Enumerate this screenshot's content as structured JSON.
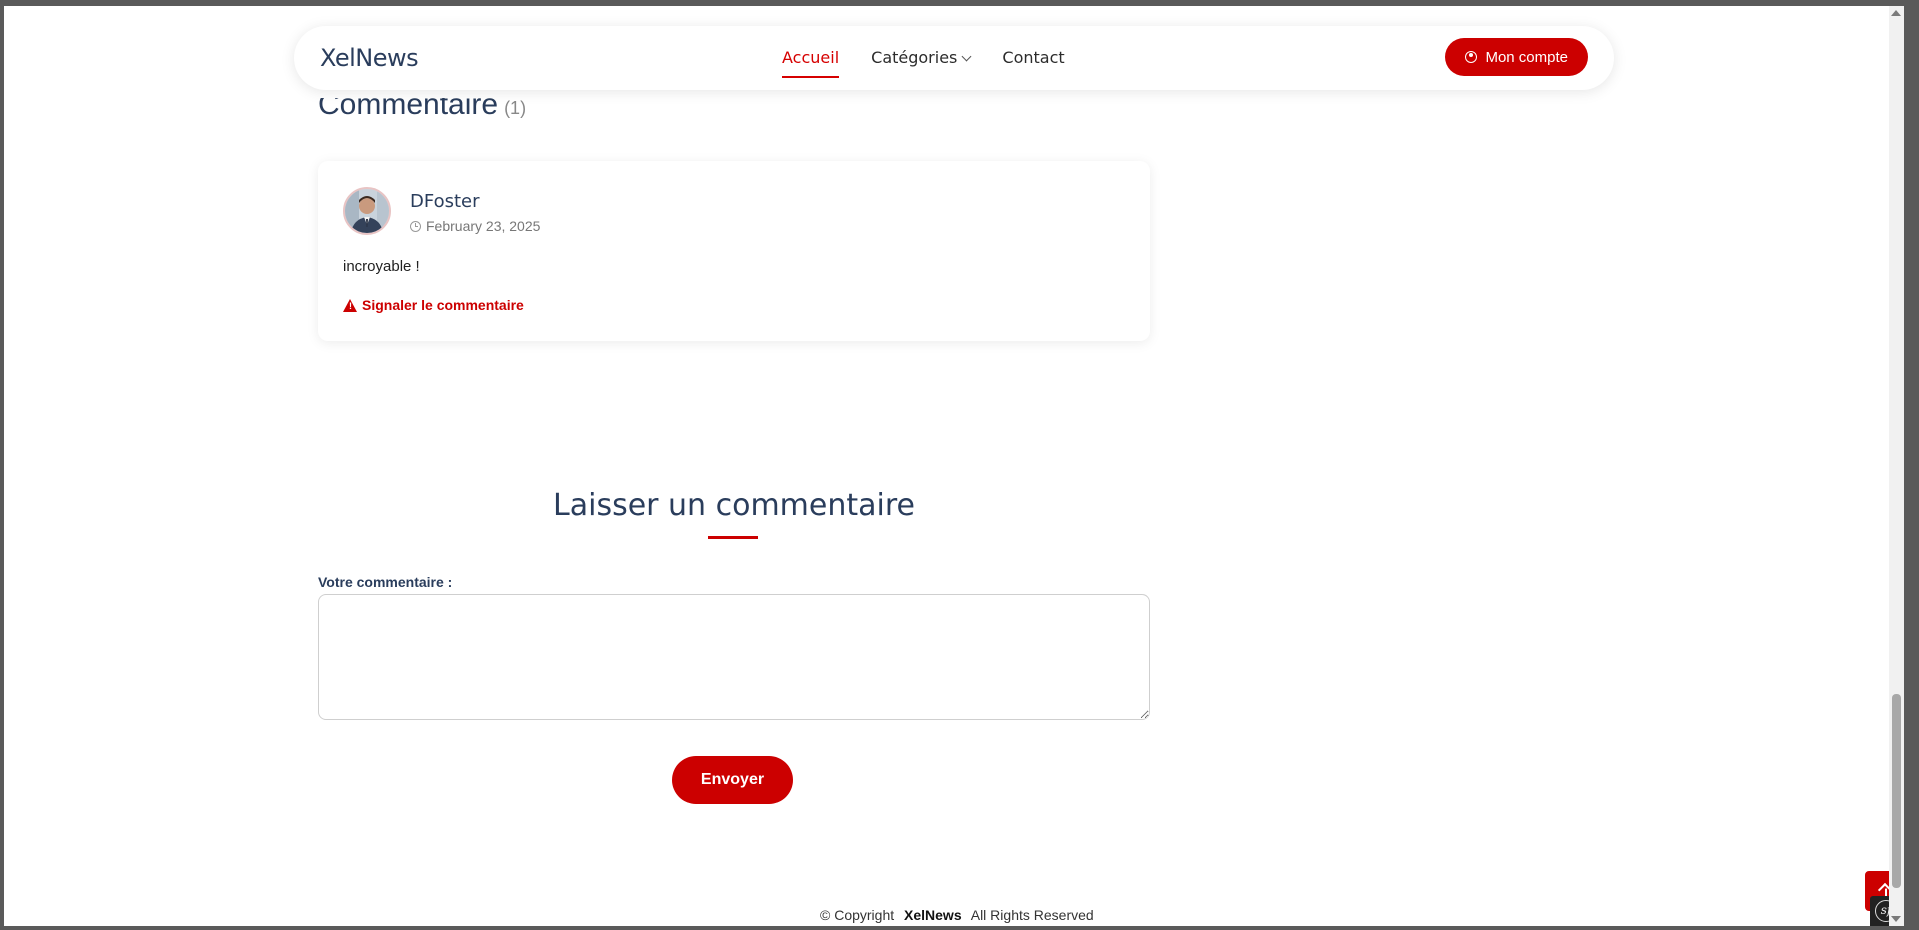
{
  "header": {
    "brand": "XelNews",
    "nav": [
      {
        "label": "Accueil",
        "active": true
      },
      {
        "label": "Catégories",
        "active": false,
        "has_dropdown": true
      },
      {
        "label": "Contact",
        "active": false
      }
    ],
    "account_label": "Mon compte"
  },
  "comments": {
    "title": "Commentaire",
    "count": "(1)",
    "items": [
      {
        "author": "DFoster",
        "date": "February 23, 2025",
        "text": "incroyable !",
        "report_label": "Signaler le commentaire"
      }
    ]
  },
  "comment_form": {
    "title": "Laisser un commentaire",
    "label": "Votre commentaire :",
    "value": "",
    "submit_label": "Envoyer"
  },
  "footer": {
    "copyright_prefix": "© Copyright",
    "brand": "XelNews",
    "suffix": "All Rights Reserved"
  },
  "colors": {
    "accent": "#cc0000",
    "heading": "#2a3d5c"
  },
  "icons": {
    "account": "user-circle-icon",
    "date": "clock-icon",
    "report": "warning-triangle-icon",
    "back_to_top": "arrow-up-icon",
    "dev_toolbar": "symfony-icon"
  }
}
